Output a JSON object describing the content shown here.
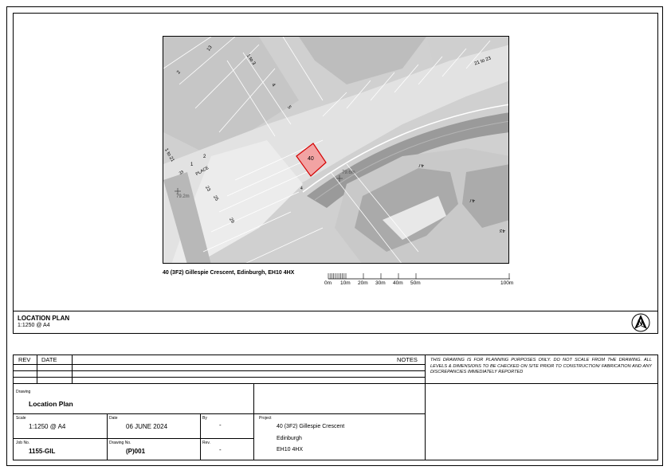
{
  "map": {
    "plot_number": "40",
    "labels": {
      "l13": "13",
      "l2a": "2",
      "l1to3": "1 to 3",
      "l4": "4",
      "l5": "5",
      "l21to23a": "21 to 23",
      "l1to21": "1 to 21",
      "l1": "1",
      "l2b": "2",
      "place": "PLACE",
      "l33": "33",
      "l23": "23",
      "l29": "29",
      "l25": "25",
      "elev1": "79.2m",
      "elev2": "79.6m",
      "l47a": "47",
      "l47b": "47",
      "l43": "43",
      "l4b": "4"
    },
    "caption": "40 (3F2) Gillespie Crescent, Edinburgh, EH10 4HX"
  },
  "scalebar": {
    "labels": [
      "0m",
      "10m",
      "20m",
      "30m",
      "40m",
      "50m",
      "100m"
    ]
  },
  "location_plan": {
    "title": "LOCATION PLAN",
    "scale": "1:1250 @ A4"
  },
  "north_arrow": {
    "letter": "N"
  },
  "title_block": {
    "rev_header": "REV",
    "date_header": "DATE",
    "notes_header": "NOTES",
    "notes_text": "THIS DRAWING IS FOR PLANNING PURPOSES ONLY.  DO NOT SCALE FROM THE DRAWING. ALL LEVELS & DIMENSIONS TO BE CHECKED ON SITE PRIOR TO CONSTRUCTION/ FABRICATION AND ANY DISCREPANCIES IMMEDIATELY REPORTED",
    "drawing_label": "Drawing",
    "drawing_value": "Location Plan",
    "scale_label": "Scale",
    "scale_value": "1:1250 @ A4",
    "date_label": "Date",
    "date_value": "06 JUNE 2024",
    "by_label": "By",
    "by_value": "-",
    "project_label": "Project",
    "project_line1": "40 (3F2) Gillespie Crescent",
    "project_line2": "Edinburgh",
    "project_line3": "EH10 4HX",
    "job_label": "Job No.",
    "job_value": "1155-GIL",
    "drawing_no_label": "Drawing No.",
    "drawing_no_value": "(P)001",
    "rev_label": "Rev.",
    "rev_value": "-"
  }
}
